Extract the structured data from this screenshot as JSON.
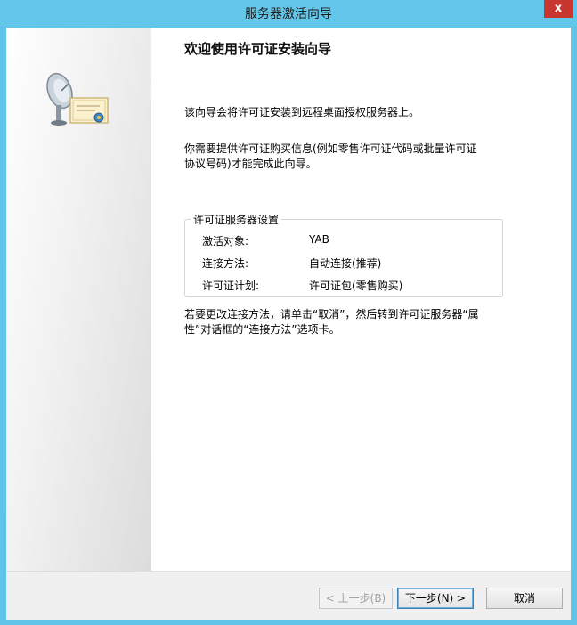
{
  "window": {
    "title": "服务器激活向导",
    "close_glyph": "x"
  },
  "main": {
    "heading": "欢迎使用许可证安装向导",
    "intro": "该向导会将许可证安装到远程桌面授权服务器上。",
    "info_line1": "你需要提供许可证购买信息(例如零售许可证代码或批量许可证",
    "info_line2": "协议号码)才能完成此向导。",
    "settings": {
      "title": "许可证服务器设置",
      "rows": [
        {
          "label": "激活对象:",
          "value": "YAB"
        },
        {
          "label": "连接方法:",
          "value": "自动连接(推荐)"
        },
        {
          "label": "许可证计划:",
          "value": "许可证包(零售购买)"
        }
      ]
    },
    "note_line1": "若要更改连接方法，请单击“取消”，然后转到许可证服务器“属",
    "note_line2": "性”对话框的“连接方法”选项卡。"
  },
  "footer": {
    "back_label": "< 上一步(B)",
    "next_label": "下一步(N) >",
    "cancel_label": "取消"
  },
  "icons": {
    "wizard_icon": "satellite-dish-certificate-icon"
  }
}
